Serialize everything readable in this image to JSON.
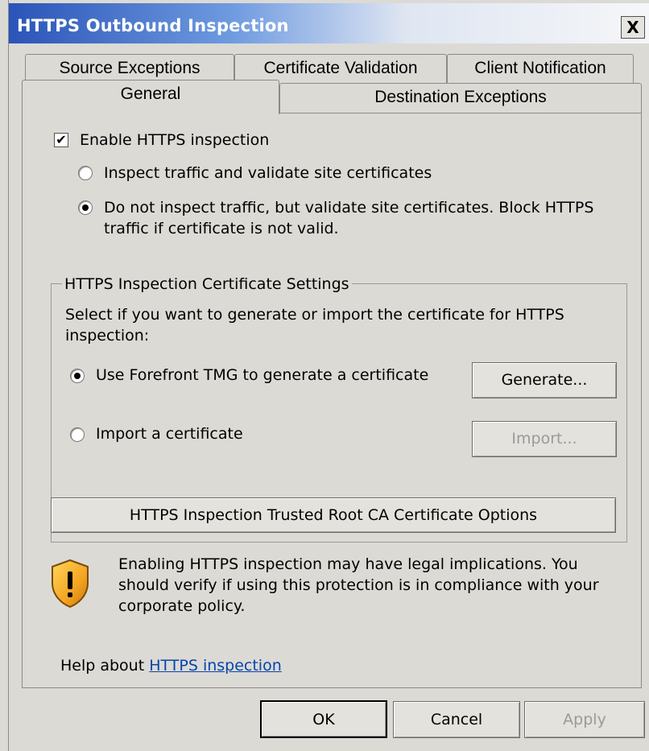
{
  "window": {
    "title": "HTTPS Outbound Inspection",
    "close_label": "X"
  },
  "tabs": {
    "row1": [
      "Source Exceptions",
      "Certificate Validation",
      "Client Notification"
    ],
    "row2": [
      "General",
      "Destination Exceptions"
    ],
    "active": "General"
  },
  "general": {
    "enable_label": "Enable HTTPS inspection",
    "enable_checked": true,
    "mode_options": [
      {
        "label": "Inspect traffic and validate site certificates",
        "selected": false
      },
      {
        "label_line1": "Do not inspect traffic, but validate site certificates. Block HTTPS",
        "label_line2": "traffic if certificate is not valid.",
        "selected": true
      }
    ],
    "cert_group": {
      "title": "HTTPS Inspection Certificate Settings",
      "desc_line1": "Select if you want to generate or import the certificate for HTTPS",
      "desc_line2": "inspection:",
      "options": [
        {
          "label": "Use Forefront TMG to generate a certificate",
          "selected": true,
          "button": "Generate...",
          "button_enabled": true
        },
        {
          "label": "Import a certificate",
          "selected": false,
          "button": "Import...",
          "button_enabled": false
        }
      ],
      "trusted_root_button": "HTTPS Inspection Trusted Root CA Certificate Options"
    },
    "warning": {
      "icon": "shield-warning-icon",
      "line1": "Enabling HTTPS inspection may have legal implications. You",
      "line2": "should verify if using this protection is in compliance with your",
      "line3": "corporate policy."
    },
    "help": {
      "prefix": "Help about ",
      "link": "HTTPS inspection"
    }
  },
  "footer": {
    "ok": "OK",
    "cancel": "Cancel",
    "apply": "Apply"
  },
  "colors": {
    "title_gradient_start": "#2a54b8",
    "dialog_bg": "#dcdad5",
    "link": "#0645ad"
  }
}
